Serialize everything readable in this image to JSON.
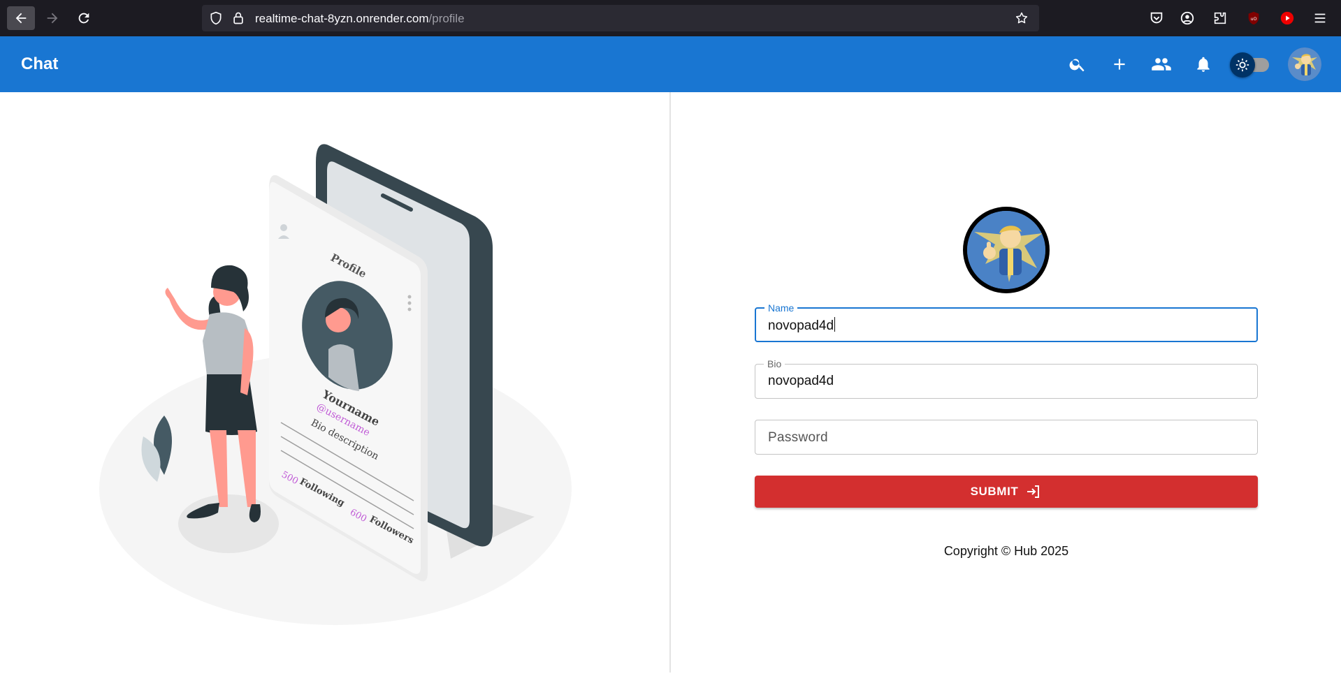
{
  "browser": {
    "url_host": "realtime-chat-8yzn.onrender.com",
    "url_path": "/profile"
  },
  "app": {
    "title": "Chat",
    "icons": [
      "search-icon",
      "add-icon",
      "group-icon",
      "bell-icon",
      "theme-toggle",
      "avatar"
    ]
  },
  "illustration": {
    "heading": "Profile",
    "username": "Yourname",
    "handle": "@username",
    "bio": "Bio description",
    "following_count": "500",
    "following_label": "Following",
    "followers_count": "600",
    "followers_label": "Followers"
  },
  "form": {
    "name_label": "Name",
    "name_value": "novopad4d",
    "bio_label": "Bio",
    "bio_value": "novopad4d",
    "password_placeholder": "Password",
    "submit_label": "SUBMIT"
  },
  "footer": {
    "copyright": "Copyright © Hub 2025"
  },
  "colors": {
    "app_bar": "#1976d2",
    "submit": "#d32f2f",
    "accent_pink": "#c05bd6"
  }
}
